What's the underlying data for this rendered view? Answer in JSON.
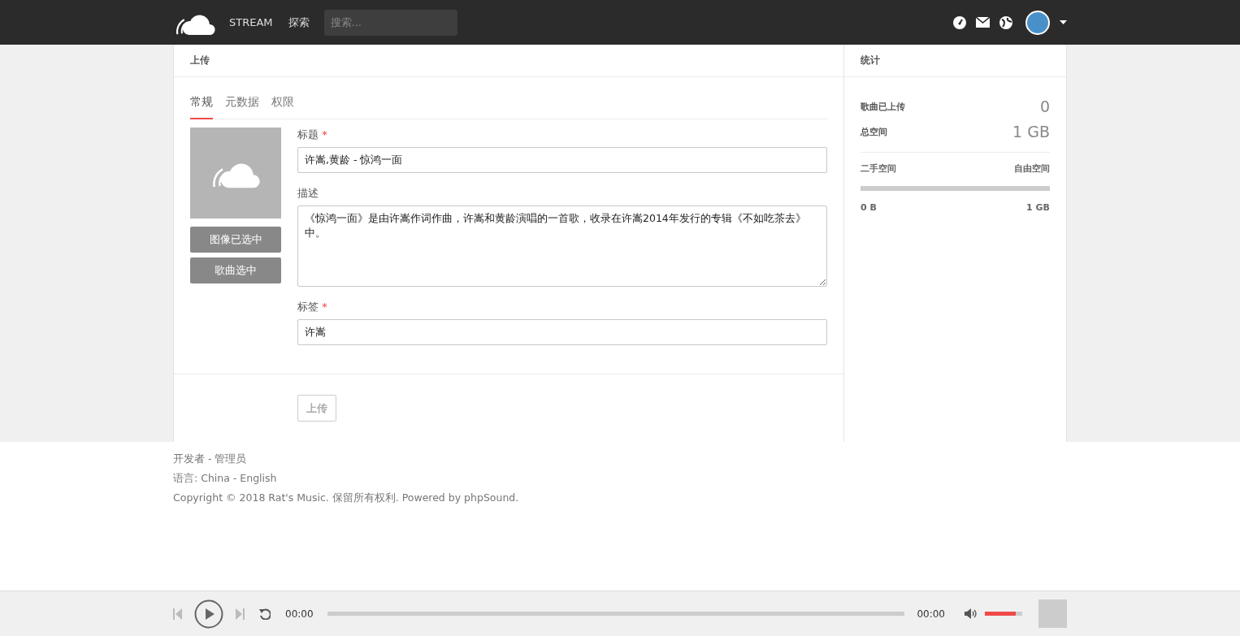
{
  "header": {
    "nav": [
      {
        "label": "STREAM"
      },
      {
        "label": "探索"
      }
    ],
    "search": {
      "placeholder": "搜索..."
    }
  },
  "upload": {
    "title": "上传",
    "tabs": [
      {
        "label": "常规",
        "selected": true
      },
      {
        "label": "元数据",
        "selected": false
      },
      {
        "label": "权限",
        "selected": false
      }
    ],
    "image_buttons": [
      "图像已选中",
      "歌曲选中"
    ],
    "fields": [
      {
        "kind": "input",
        "label": "标题",
        "required_mark": "*",
        "value": "许嵩,黄龄 - 惊鸿一面"
      },
      {
        "kind": "textarea",
        "label": "描述",
        "value": "《惊鸿一面》是由许嵩作词作曲，许嵩和黄龄演唱的一首歌，收录在许嵩2014年发行的专辑《不如吃茶去》中。"
      },
      {
        "kind": "input",
        "label": "标签",
        "required_mark": "*",
        "value": "许嵩"
      }
    ],
    "submit": {
      "label": "上传",
      "disabled": true
    }
  },
  "stats": {
    "title": "统计",
    "rows": [
      {
        "label": "歌曲已上传",
        "value": "0"
      },
      {
        "label": "总空间",
        "value": "1 GB"
      }
    ],
    "space": {
      "used_label": "二手空间",
      "free_label": "自由空间",
      "level": 0,
      "min": "0 B",
      "max": "1 GB"
    }
  },
  "footer": {
    "lines": [
      "开发者 - 管理员",
      "语言: China - English",
      "Copyright © 2018 Rat's Music. 保留所有权利. Powered by phpSound."
    ]
  },
  "player": {
    "current_time": "00:00",
    "progress": {
      "level": 0
    },
    "duration": "00:00",
    "volume": {
      "level": 0.82
    }
  }
}
